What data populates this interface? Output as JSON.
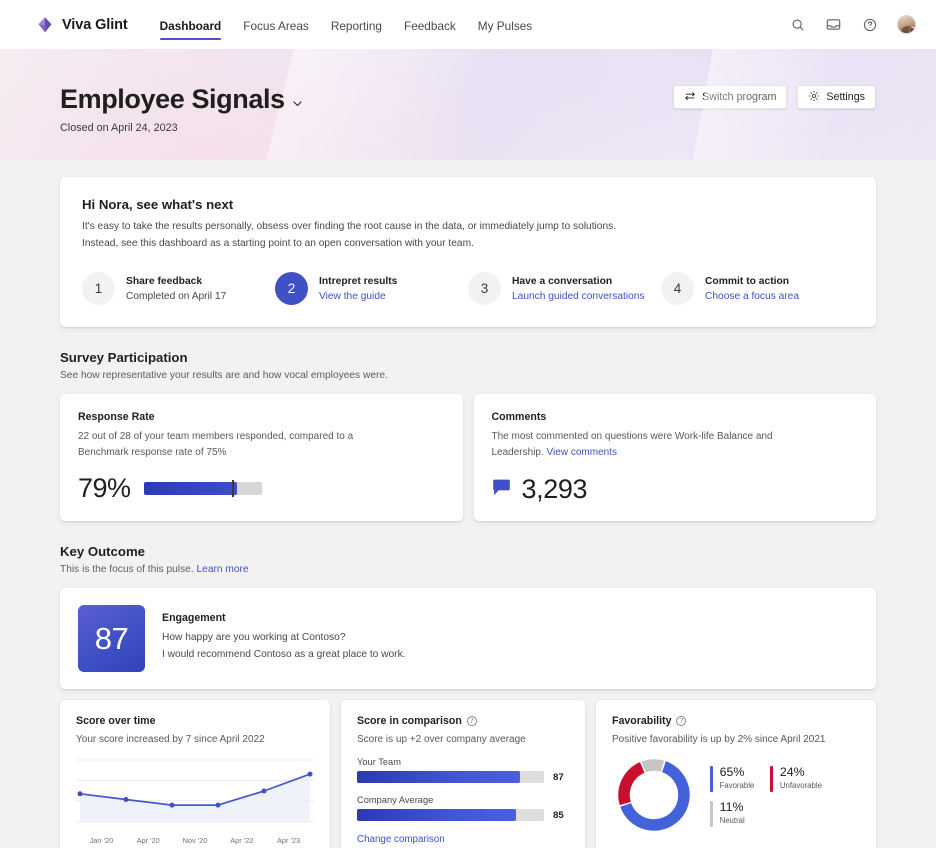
{
  "topnav": {
    "brand": "Viva Glint",
    "links": [
      {
        "label": "Dashboard",
        "active": true
      },
      {
        "label": "Focus Areas",
        "active": false
      },
      {
        "label": "Reporting",
        "active": false
      },
      {
        "label": "Feedback",
        "active": false
      },
      {
        "label": "My Pulses",
        "active": false
      }
    ],
    "icons": [
      "search-icon",
      "inbox-icon",
      "help-icon"
    ],
    "avatar_alt": "Nora"
  },
  "hero": {
    "title": "Employee Signals",
    "subtitle": "Closed on April 24, 2023",
    "switch_program_label": "Switch program",
    "settings_label": "Settings"
  },
  "next_steps": {
    "title": "Hi Nora, see what's next",
    "body_line1": "It's easy to take the results personally, obsess over finding the root cause in the data, or immediately jump to solutions.",
    "body_line2": "Instead, see this dashboard as a starting point to an open conversation with your team.",
    "steps": [
      {
        "number": "1",
        "name": "Share feedback",
        "meta": "Completed on April 17",
        "link": null,
        "current": false
      },
      {
        "number": "2",
        "name": "Intrepret results",
        "meta": null,
        "link": "View the guide",
        "current": true
      },
      {
        "number": "3",
        "name": "Have a conversation",
        "meta": null,
        "link": "Launch guided conversations",
        "current": false
      },
      {
        "number": "4",
        "name": "Commit to action",
        "meta": null,
        "link": "Choose a focus area",
        "current": false
      }
    ]
  },
  "survey_participation": {
    "title": "Survey Participation",
    "subtitle": "See how representative your results are and how vocal employees were.",
    "response_rate": {
      "title": "Response Rate",
      "desc_line1": "22 out of 28 of your team members responded, compared to a",
      "desc_line2": "Benchmark response rate of 75%",
      "percent_label": "79%",
      "percent_value": 79,
      "benchmark_value": 75,
      "responded": 22,
      "total": 28
    },
    "comments": {
      "title": "Comments",
      "desc_line1": "The most commented on questions were Work-life Balance and",
      "desc_line2_prefix": "Leadership.",
      "desc_link": "View comments",
      "count": "3,293"
    }
  },
  "key_outcome": {
    "title": "Key Outcome",
    "subtitle_prefix": "This is the focus of this pulse.",
    "subtitle_link": "Learn more",
    "score": "87",
    "name": "Engagement",
    "question_line1": "How happy are you working at Contoso?",
    "question_line2": "I would recommend Contoso as a great place to work."
  },
  "colors": {
    "accent": "#3f51c5",
    "bar_fill": "#3b4ecb",
    "favorable": "#4361d8",
    "unfavorable": "#c8102e",
    "neutral": "#c8c6c4",
    "track": "#d8d7d5"
  },
  "chart_data": [
    {
      "type": "line",
      "title": "Score over time",
      "subtitle": "Your score increased by 7 since April 2022",
      "xlabel": "",
      "ylabel": "",
      "categories": [
        "Jan '20",
        "Apr '20",
        "Nov '20",
        "Apr '22",
        "Apr '23"
      ],
      "tick_labels": [
        "Jan '20",
        "Apr '20",
        "Nov '20",
        "Apr '22",
        "Apr '23"
      ],
      "x": [
        0,
        1,
        2,
        3,
        4,
        5
      ],
      "values": [
        80,
        78,
        76,
        76,
        81,
        87
      ],
      "ylim": [
        70,
        92
      ],
      "grid": true,
      "legend": "none",
      "area_fill": true
    },
    {
      "type": "bar",
      "title": "Score in comparison",
      "subtitle": "Score is up +2 over company average",
      "orientation": "horizontal",
      "categories": [
        "Your Team",
        "Company Average"
      ],
      "values": [
        87,
        85
      ],
      "value_labels": [
        "87",
        "85"
      ],
      "xlim": [
        0,
        100
      ],
      "grid": false,
      "legend": "none",
      "footer_link": "Change comparison",
      "has_info_icon": true
    },
    {
      "type": "pie",
      "subtype": "donut",
      "title": "Favorability",
      "subtitle": "Positive favorability is up by 2% since April 2021",
      "labels": [
        "Favorable",
        "Unfavorable",
        "Neutral"
      ],
      "values": [
        65,
        24,
        11
      ],
      "value_labels": [
        "65%",
        "24%",
        "11%"
      ],
      "colors": [
        "#4361d8",
        "#c8102e",
        "#c8c6c4"
      ],
      "legend": "right",
      "has_info_icon": true
    }
  ]
}
